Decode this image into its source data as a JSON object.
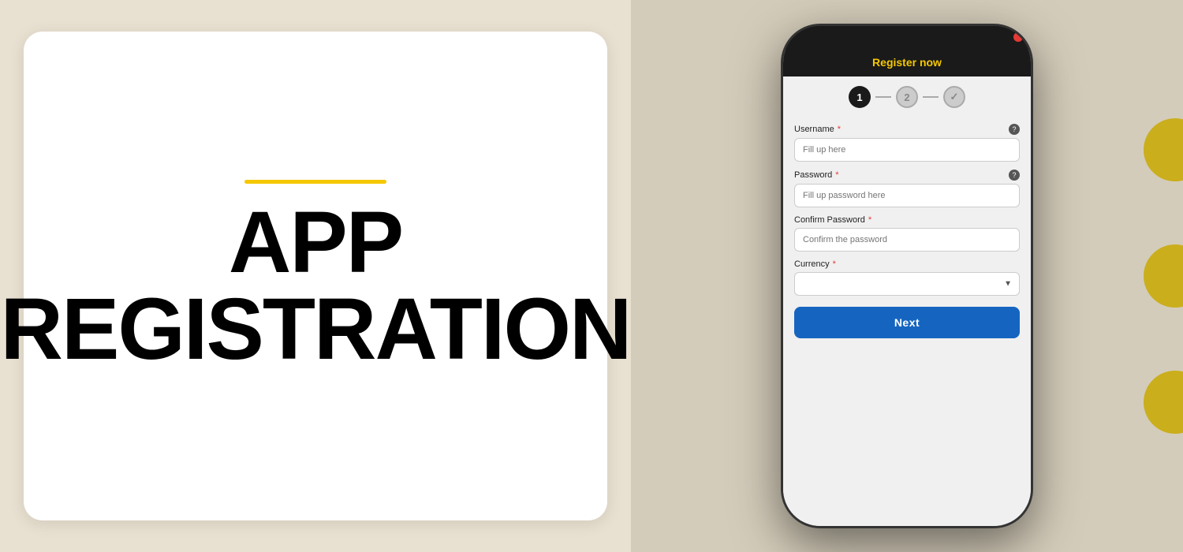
{
  "left": {
    "yellow_line": "decorative line",
    "title_line1": "APP",
    "title_line2": "REGISTRATION"
  },
  "right": {
    "phone": {
      "header_title": "Register now",
      "steps": [
        {
          "label": "1",
          "state": "active"
        },
        {
          "label": "2",
          "state": "inactive"
        },
        {
          "label": "✓",
          "state": "done"
        }
      ],
      "form": {
        "username_label": "Username",
        "username_placeholder": "Fill up here",
        "password_label": "Password",
        "password_placeholder": "Fill up password here",
        "confirm_label": "Confirm Password",
        "confirm_placeholder": "Confirm the password",
        "currency_label": "Currency",
        "currency_placeholder": "",
        "next_button": "Next"
      }
    }
  }
}
